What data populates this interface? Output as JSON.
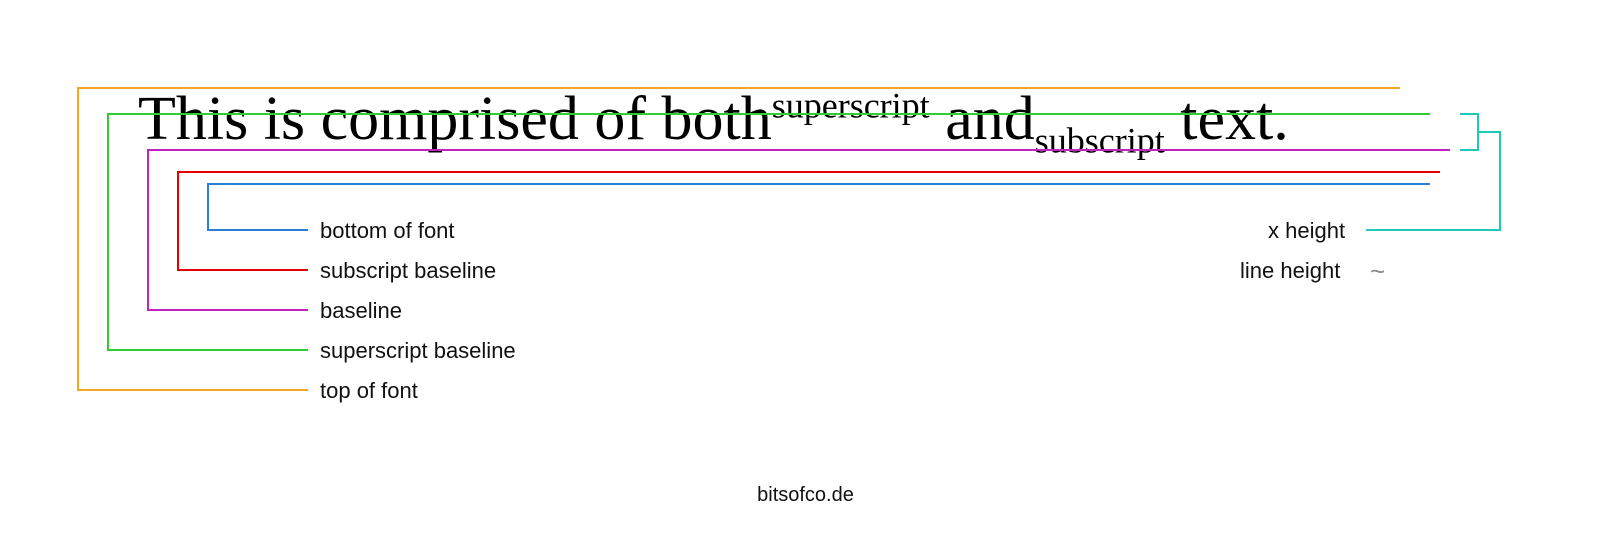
{
  "sentence": {
    "part1": "This is comprised of both",
    "sup": "superscript",
    "part2": " and",
    "sub": "subscript",
    "part3": " text."
  },
  "left_labels": {
    "bottom_of_font": "bottom of font",
    "subscript_baseline": "subscript baseline",
    "baseline": "baseline",
    "superscript_baseline": "superscript baseline",
    "top_of_font": "top of font"
  },
  "right_labels": {
    "x_height": "x height",
    "line_height": "line height",
    "tilde": "~"
  },
  "footer": "bitsofco.de",
  "colors": {
    "top_of_font": "#f5a623",
    "superscript_baseline": "#33cc33",
    "baseline": "#c122c1",
    "subscript_baseline": "#e60000",
    "bottom_of_font": "#2b7fd6",
    "x_height": "#1fc9b5",
    "line_height": "#8a8a8a"
  }
}
